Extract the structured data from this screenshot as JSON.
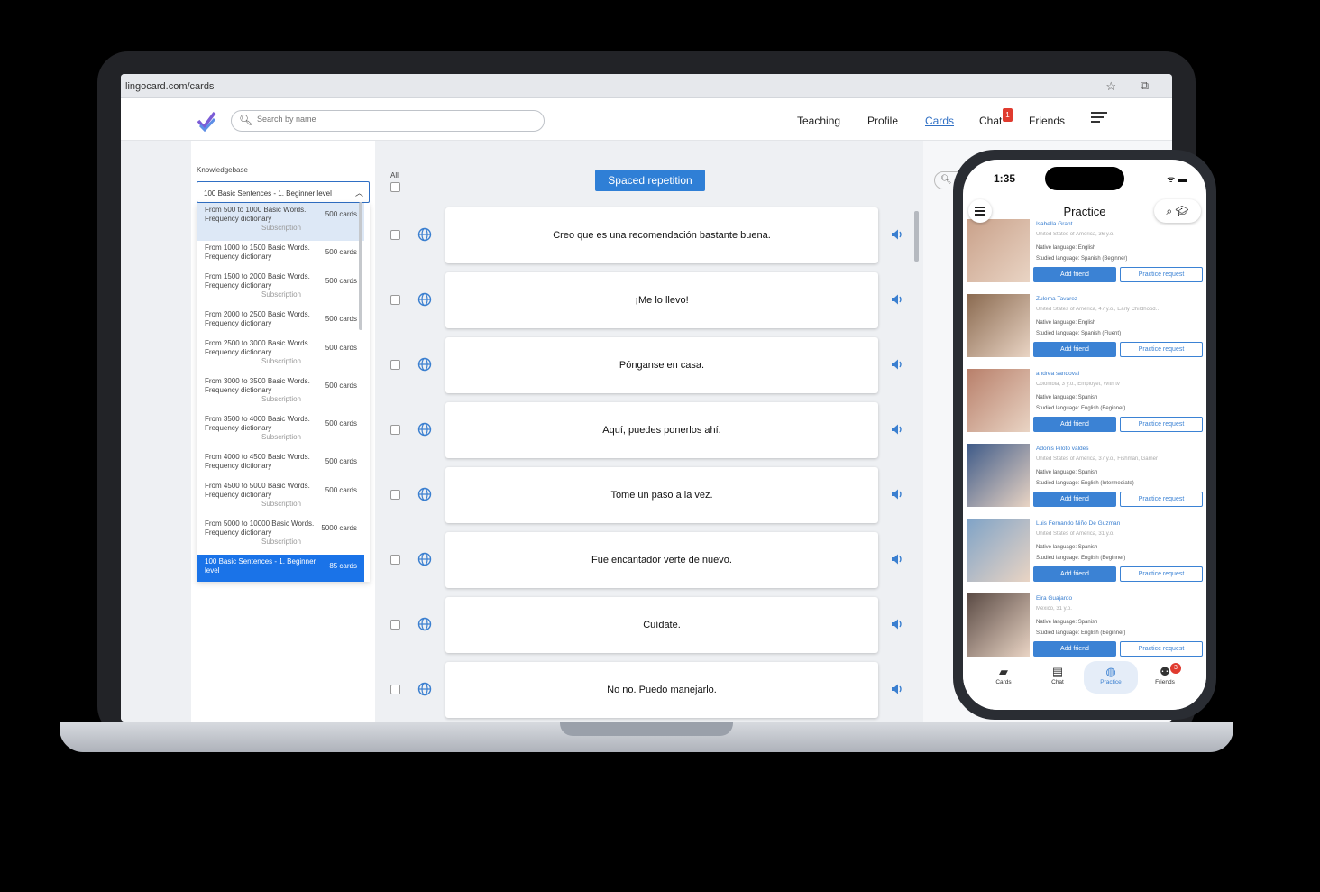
{
  "browser": {
    "url": "lingocard.com/cards"
  },
  "nav": {
    "search_placeholder": "Search by name",
    "links": [
      "Teaching",
      "Profile",
      "Cards",
      "Chat",
      "Friends"
    ],
    "chat_badge": "1"
  },
  "sidebar": {
    "label": "Knowledgebase",
    "selected": "100 Basic Sentences - 1. Beginner level",
    "items": [
      {
        "name": "From 500 to 1000 Basic Words. Frequency dictionary",
        "count": "500 cards",
        "sub": "Subscription"
      },
      {
        "name": "From 1000 to 1500 Basic Words. Frequency dictionary",
        "count": "500 cards",
        "sub": ""
      },
      {
        "name": "From 1500 to 2000 Basic Words. Frequency dictionary",
        "count": "500 cards",
        "sub": "Subscription"
      },
      {
        "name": "From 2000 to 2500 Basic Words. Frequency dictionary",
        "count": "500 cards",
        "sub": ""
      },
      {
        "name": "From 2500 to 3000 Basic Words. Frequency dictionary",
        "count": "500 cards",
        "sub": "Subscription"
      },
      {
        "name": "From 3000 to 3500 Basic Words. Frequency dictionary",
        "count": "500 cards",
        "sub": "Subscription"
      },
      {
        "name": "From 3500 to 4000 Basic Words. Frequency dictionary",
        "count": "500 cards",
        "sub": "Subscription"
      },
      {
        "name": "From 4000 to 4500 Basic Words. Frequency dictionary",
        "count": "500 cards",
        "sub": ""
      },
      {
        "name": "From 4500 to 5000 Basic Words. Frequency dictionary",
        "count": "500 cards",
        "sub": "Subscription"
      },
      {
        "name": "From 5000 to 10000 Basic Words. Frequency dictionary",
        "count": "5000 cards",
        "sub": "Subscription"
      },
      {
        "name": "100 Basic Sentences - 1. Beginner level",
        "count": "85 cards",
        "sub": ""
      }
    ]
  },
  "cards_panel": {
    "all_label": "All",
    "spaced_repetition": "Spaced repetition",
    "cards": [
      "Creo que es una recomendación bastante buena.",
      "¡Me lo llevo!",
      "Pónganse en casa.",
      "Aquí, puedes ponerlos ahí.",
      "Tome un paso a la vez.",
      "Fue encantador verte de nuevo.",
      "Cuídate.",
      "No no. Puedo manejarlo."
    ]
  },
  "phone": {
    "time": "1:35",
    "title": "Practice",
    "add_friend": "Add friend",
    "practice_request": "Practice request",
    "users": [
      {
        "name": "Isabella Grant",
        "meta": "United States of America, 36 y.o.",
        "native": "Native language: English",
        "studied": "Studied language: Spanish (Beginner)"
      },
      {
        "name": "Zulema Tavarez",
        "meta": "United States of America, 47 y.o., Early Childhood…",
        "native": "Native language: English",
        "studied": "Studied language: Spanish (Fluent)"
      },
      {
        "name": "andrea sandoval",
        "meta": "Colombia, 3 y.o., Employet, With tv",
        "native": "Native language: Spanish",
        "studied": "Studied language: English (Beginner)"
      },
      {
        "name": "Adonis Piloto valdes",
        "meta": "United States of America, 37 y.o., Fishman, Gamer",
        "native": "Native language: Spanish",
        "studied": "Studied language: English (Intermediate)"
      },
      {
        "name": "Luis Fernando Niño De Guzman",
        "meta": "United States of America, 31 y.o.",
        "native": "Native language: Spanish",
        "studied": "Studied language: English (Beginner)"
      },
      {
        "name": "Eira Guajardo",
        "meta": "Mexico, 31 y.o.",
        "native": "Native language: Spanish",
        "studied": "Studied language: English (Beginner)"
      }
    ],
    "tabs": [
      "Cards",
      "Chat",
      "Practice",
      "Friends"
    ],
    "friends_badge": "3"
  }
}
